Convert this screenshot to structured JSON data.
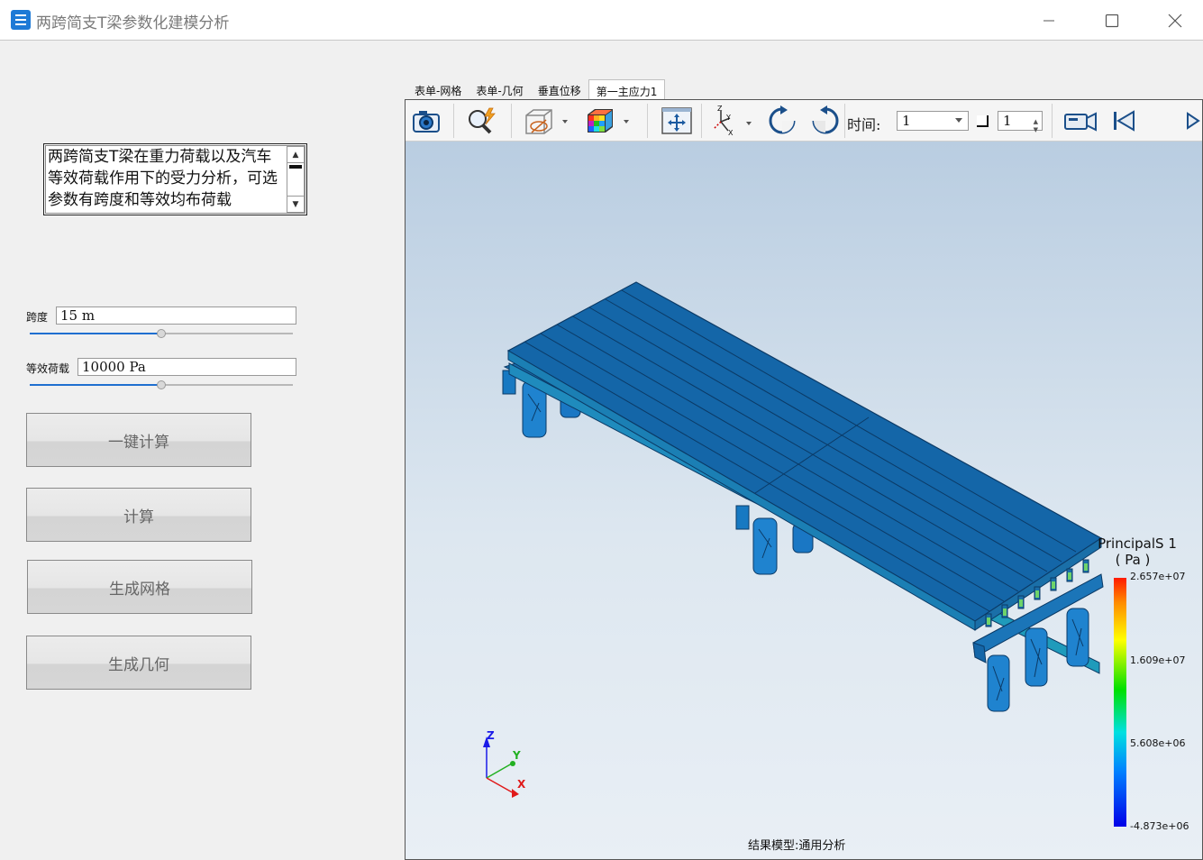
{
  "window": {
    "title": "两跨简支T梁参数化建模分析",
    "icon": "app-grid-icon"
  },
  "description": {
    "text": "两跨简支T梁在重力荷载以及汽车等效荷载作用下的受力分析，可选参数有跨度和等效均布荷载"
  },
  "params": {
    "span": {
      "label": "跨度",
      "value": "15  m",
      "slider_fraction": 0.5
    },
    "load": {
      "label": "等效荷载",
      "value": "10000  Pa",
      "slider_fraction": 0.5
    }
  },
  "buttons": {
    "one_click": "一键计算",
    "compute": "计算",
    "gen_mesh": "生成网格",
    "gen_geometry": "生成几何"
  },
  "tabs": [
    "表单-网格",
    "表单-几何",
    "垂直位移",
    "第一主应力1"
  ],
  "active_tab": 3,
  "toolbar": {
    "icons": [
      "camera-icon",
      "zoom-icon",
      "view-box-icon",
      "color-cube-icon",
      "fit-view-icon",
      "axes-icon",
      "rotate-cw-icon",
      "rotate-ccw-icon",
      "record-camera-icon",
      "first-frame-icon",
      "next-frame-icon"
    ],
    "time_label": "时间:",
    "time_value": "1",
    "frame_value": "1"
  },
  "legend": {
    "title_line1": "PrincipalS 1",
    "title_line2": "( Pa )",
    "ticks": [
      "2.657e+07",
      "1.609e+07",
      "5.608e+06",
      "-4.873e+06"
    ],
    "colors": [
      "#ff1a00",
      "#ffff00",
      "#00e000",
      "#00e0e0",
      "#0000e8"
    ]
  },
  "axes_triad": {
    "x": "X",
    "y": "Y",
    "z": "Z"
  },
  "footer": {
    "result_model": "结果模型:通用分析"
  }
}
